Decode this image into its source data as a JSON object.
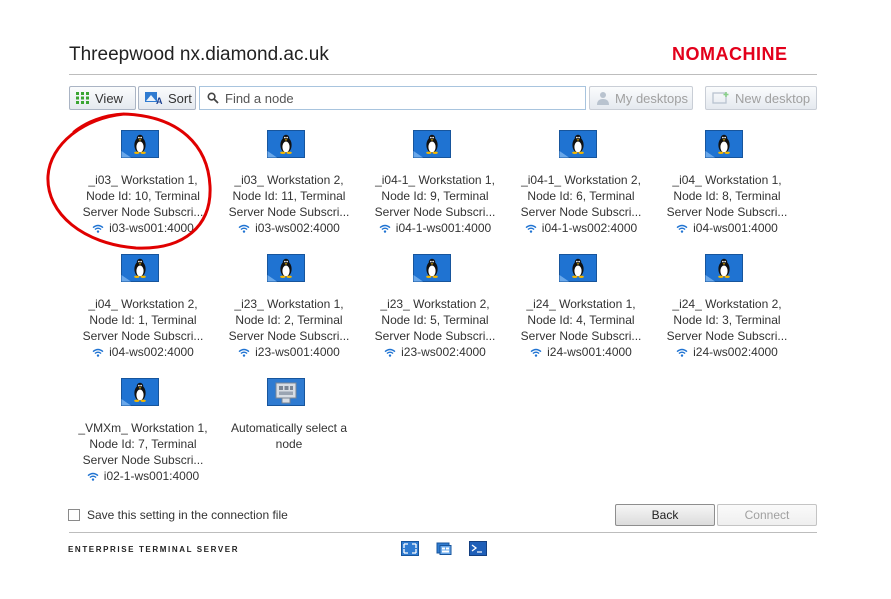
{
  "header": {
    "server_name": "Threepwood nx.diamond.ac.uk",
    "brand": "NOMACHINE"
  },
  "toolbar": {
    "view_label": "View",
    "sort_label": "Sort",
    "search_placeholder": "Find a node",
    "my_desktops_label": "My desktops",
    "new_desktop_label": "New desktop"
  },
  "nodes": [
    {
      "label": "_i03_ Workstation 1, Node Id: 10, Terminal Server Node Subscri...",
      "address": "i03-ws001:4000",
      "icon": "linux-icon"
    },
    {
      "label": "_i03_ Workstation 2, Node Id: 11, Terminal Server Node Subscri...",
      "address": "i03-ws002:4000",
      "icon": "linux-icon"
    },
    {
      "label": "_i04-1_ Workstation 1, Node Id: 9, Terminal Server Node Subscri...",
      "address": "i04-1-ws001:4000",
      "icon": "linux-icon"
    },
    {
      "label": "_i04-1_ Workstation 2, Node Id: 6, Terminal Server Node Subscri...",
      "address": "i04-1-ws002:4000",
      "icon": "linux-icon"
    },
    {
      "label": "_i04_ Workstation 1, Node Id: 8, Terminal Server Node Subscri...",
      "address": "i04-ws001:4000",
      "icon": "linux-icon"
    },
    {
      "label": "_i04_ Workstation 2, Node Id: 1, Terminal Server Node Subscri...",
      "address": "i04-ws002:4000",
      "icon": "linux-icon"
    },
    {
      "label": "_i23_ Workstation 1, Node Id: 2, Terminal Server Node Subscri...",
      "address": "i23-ws001:4000",
      "icon": "linux-icon"
    },
    {
      "label": "_i23_ Workstation 2, Node Id: 5, Terminal Server Node Subscri...",
      "address": "i23-ws002:4000",
      "icon": "linux-icon"
    },
    {
      "label": "_i24_ Workstation 1, Node Id: 4, Terminal Server Node Subscri...",
      "address": "i24-ws001:4000",
      "icon": "linux-icon"
    },
    {
      "label": "_i24_ Workstation 2, Node Id: 3, Terminal Server Node Subscri...",
      "address": "i24-ws002:4000",
      "icon": "linux-icon"
    },
    {
      "label": "_VMXm_ Workstation 1, Node Id: 7, Terminal Server Node Subscri...",
      "address": "i02-1-ws001:4000",
      "icon": "linux-icon"
    },
    {
      "label": "Automatically select a node",
      "address": "",
      "icon": "auto-select-icon"
    }
  ],
  "footer": {
    "save_setting_label": "Save this setting in the connection file",
    "save_setting_checked": false,
    "back_label": "Back",
    "connect_label": "Connect",
    "product_name": "ENTERPRISE TERMINAL SERVER"
  },
  "colors": {
    "brand": "#e3001b",
    "icon_blue": "#1f73d2",
    "annotation": "#e00000"
  }
}
